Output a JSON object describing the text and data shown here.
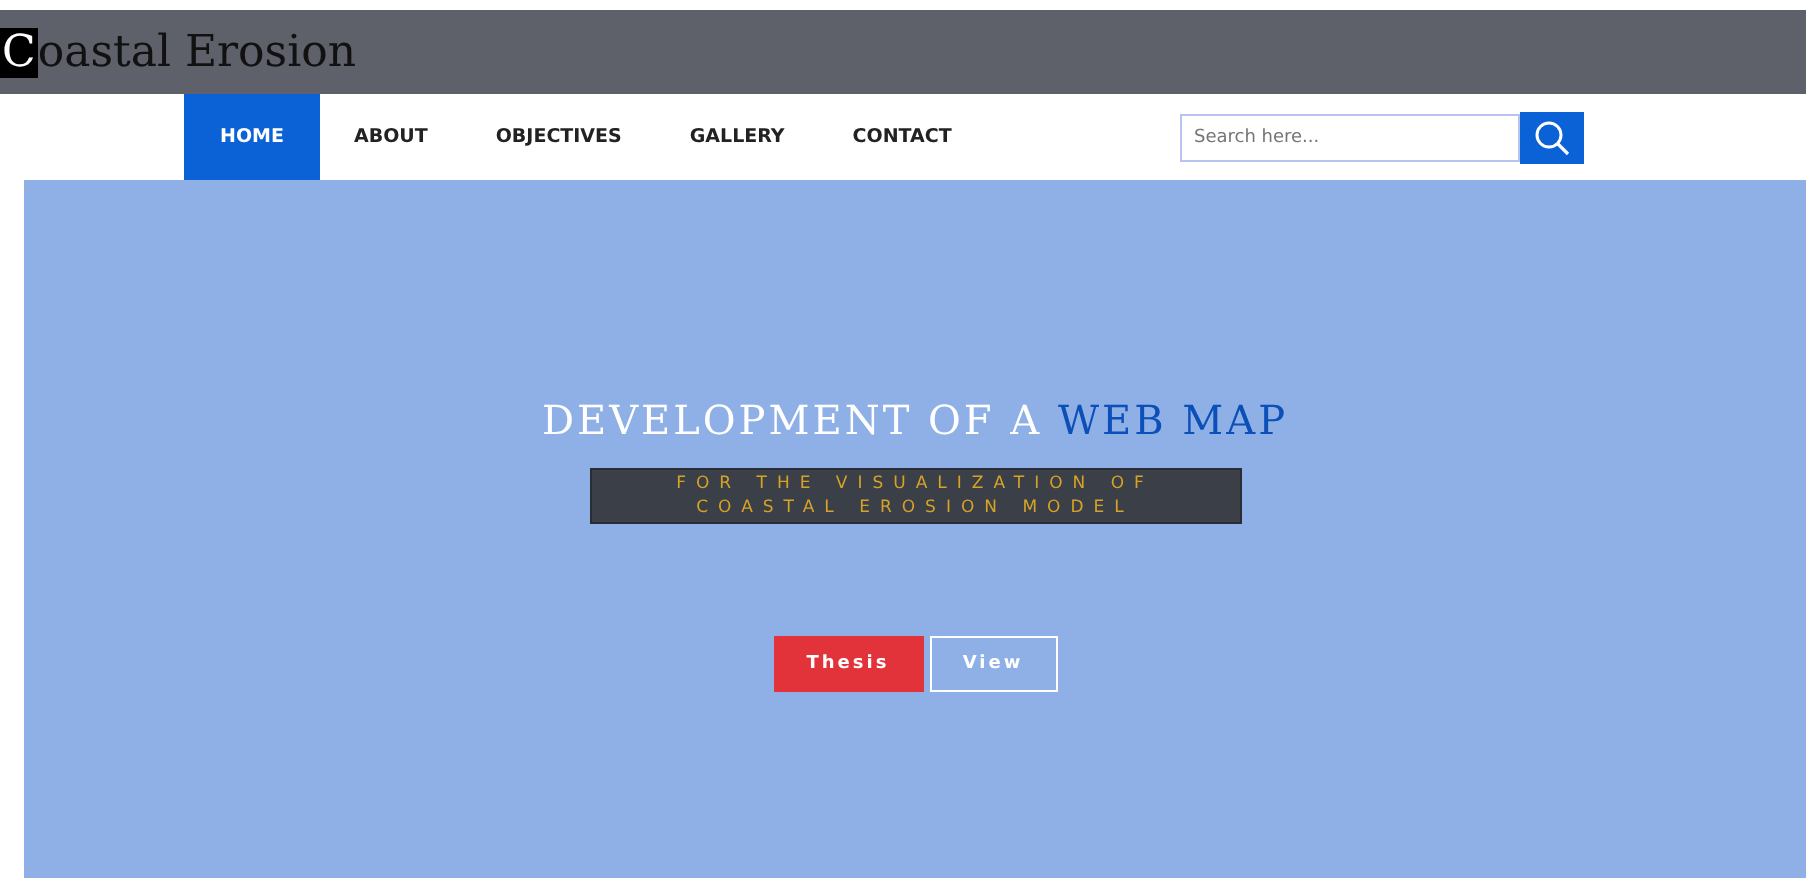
{
  "header": {
    "title_highlighted": "C",
    "title_rest": "oastal Erosion"
  },
  "nav": [
    {
      "label": "HOME",
      "selected": true
    },
    {
      "label": "ABOUT",
      "selected": false
    },
    {
      "label": "OBJECTIVES",
      "selected": false
    },
    {
      "label": "GALLERY",
      "selected": false
    },
    {
      "label": "CONTACT",
      "selected": false
    }
  ],
  "search": {
    "placeholder": "Search here..."
  },
  "hero": {
    "heading": "DEVELOPMENT OF A ",
    "heading_accent": "WEB MAP",
    "subtitle_lines": [
      "FOR THE VISUALIZATION OF",
      "COASTAL EROSION MODEL"
    ],
    "buttons": [
      {
        "label": "Thesis",
        "kind": "primary"
      },
      {
        "label": "View",
        "kind": "outline"
      }
    ]
  }
}
